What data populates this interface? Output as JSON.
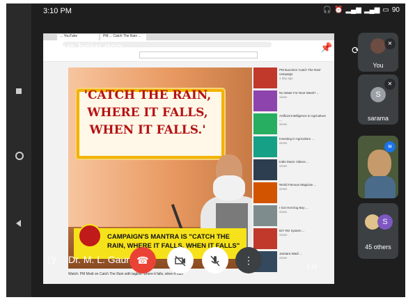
{
  "status_bar": {
    "time": "3:10 PM",
    "battery": "90"
  },
  "meeting": {
    "code": "zvc-bciw-qco",
    "chevron": "▸"
  },
  "shared_screen": {
    "browser_tabs": [
      {
        "label": "... YouTube"
      },
      {
        "label": "PM ... Catch The Rain ..."
      }
    ],
    "video": {
      "quote": "'CATCH THE RAIN, WHERE IT FALLS, WHEN IT FALLS.'",
      "banner": "CAMPAIGN'S MANTRA IS \"CATCH THE RAIN, WHERE IT FALLS, WHEN IT FALLS\"",
      "caption": "Watch: PM Modi on Catch The Rain with tagline 'where it falls, when it falls'"
    },
    "sidebar_items": [
      {
        "title": "PM launches 'Catch The Rain' campaign",
        "meta": "1 day ago"
      },
      {
        "title": "No Water For Next Week? ...",
        "meta": "views"
      },
      {
        "title": "Artificial Intelligence in Agriculture ...",
        "meta": "views"
      },
      {
        "title": "Investing in Agriculture ...",
        "meta": "views"
      },
      {
        "title": "Indie Music Videos ...",
        "meta": "views"
      },
      {
        "title": "World Famous Magician ...",
        "meta": "views"
      },
      {
        "title": "I Got Hot Dog Boy ...",
        "meta": "views"
      },
      {
        "title": "DIY RO System ...",
        "meta": "views"
      },
      {
        "title": "Jamtara Wadi ...",
        "meta": "views"
      }
    ],
    "time_display": "1:10"
  },
  "participants": [
    {
      "name": "You",
      "muted": true
    },
    {
      "name": "sarama",
      "initial": "S",
      "muted": true,
      "color": "#9aa0a6"
    },
    {
      "name": "",
      "speaking": true
    },
    {
      "name": "45 others",
      "initial": "S",
      "color": "#7e57c2"
    }
  ],
  "presenter": {
    "name": "Dr. M. L. Gaur"
  },
  "controls": {
    "end_call": "end-call",
    "camera": "camera-off",
    "mic": "mic-off",
    "more": "more"
  }
}
